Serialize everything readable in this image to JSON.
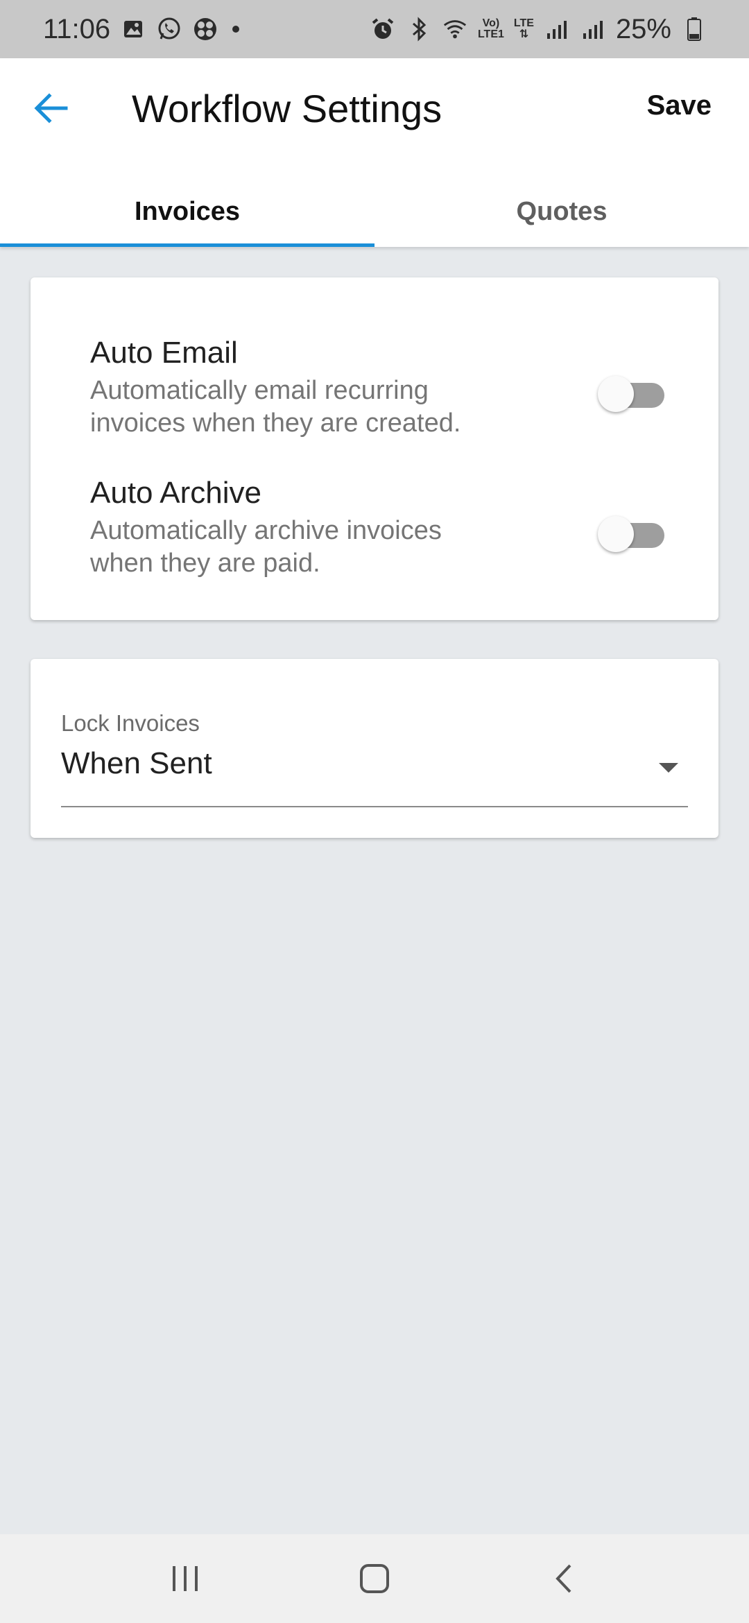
{
  "status_bar": {
    "time": "11:06",
    "left_icons": [
      "gallery-icon",
      "whatsapp-icon",
      "app-icon"
    ],
    "right_icons": [
      "alarm-icon",
      "bluetooth-icon",
      "wifi-icon",
      "volte-icon",
      "lte-icon",
      "signal-icon",
      "signal-icon"
    ],
    "volte_text_top": "Vo)",
    "volte_text_bottom": "LTE1",
    "lte_text": "LTE",
    "battery": "25%"
  },
  "appbar": {
    "title": "Workflow Settings",
    "save_label": "Save",
    "accent_color": "#1a8fd8"
  },
  "tabs": [
    {
      "label": "Invoices",
      "active": true
    },
    {
      "label": "Quotes",
      "active": false
    }
  ],
  "settings": [
    {
      "title": "Auto Email",
      "description": "Automatically email recurring invoices when they are created.",
      "enabled": false
    },
    {
      "title": "Auto Archive",
      "description": "Automatically archive invoices when they are paid.",
      "enabled": false
    }
  ],
  "lock_invoices": {
    "label": "Lock Invoices",
    "value": "When Sent"
  },
  "navbar": {
    "buttons": [
      "recents-icon",
      "home-icon",
      "back-nav-icon"
    ]
  }
}
